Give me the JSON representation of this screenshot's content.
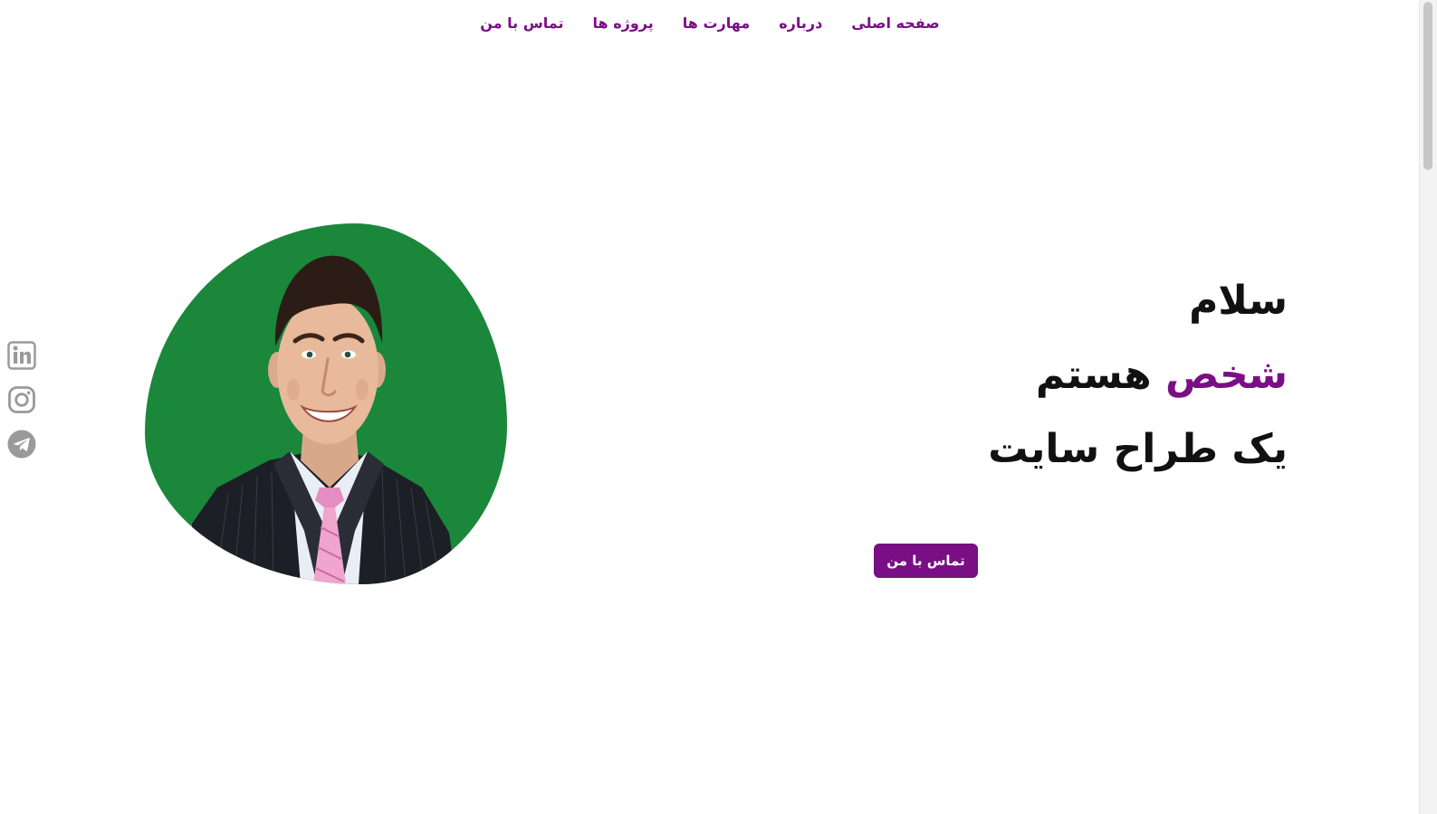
{
  "nav": {
    "items": [
      {
        "label": "صفحه اصلی"
      },
      {
        "label": "درباره"
      },
      {
        "label": "مهارت ها"
      },
      {
        "label": "پروژه ها"
      },
      {
        "label": "تماس با من"
      }
    ]
  },
  "hero": {
    "greeting": "سلام",
    "name": "شخص",
    "name_suffix": "هستم",
    "role": "یک طراح سایت",
    "button_label": "تماس با من"
  },
  "social": {
    "icons": [
      "linkedin-icon",
      "instagram-icon",
      "telegram-icon"
    ]
  },
  "colors": {
    "accent": "#7a0f85",
    "image_background": "#1a873b",
    "icon_gray": "#9a9a9a"
  }
}
